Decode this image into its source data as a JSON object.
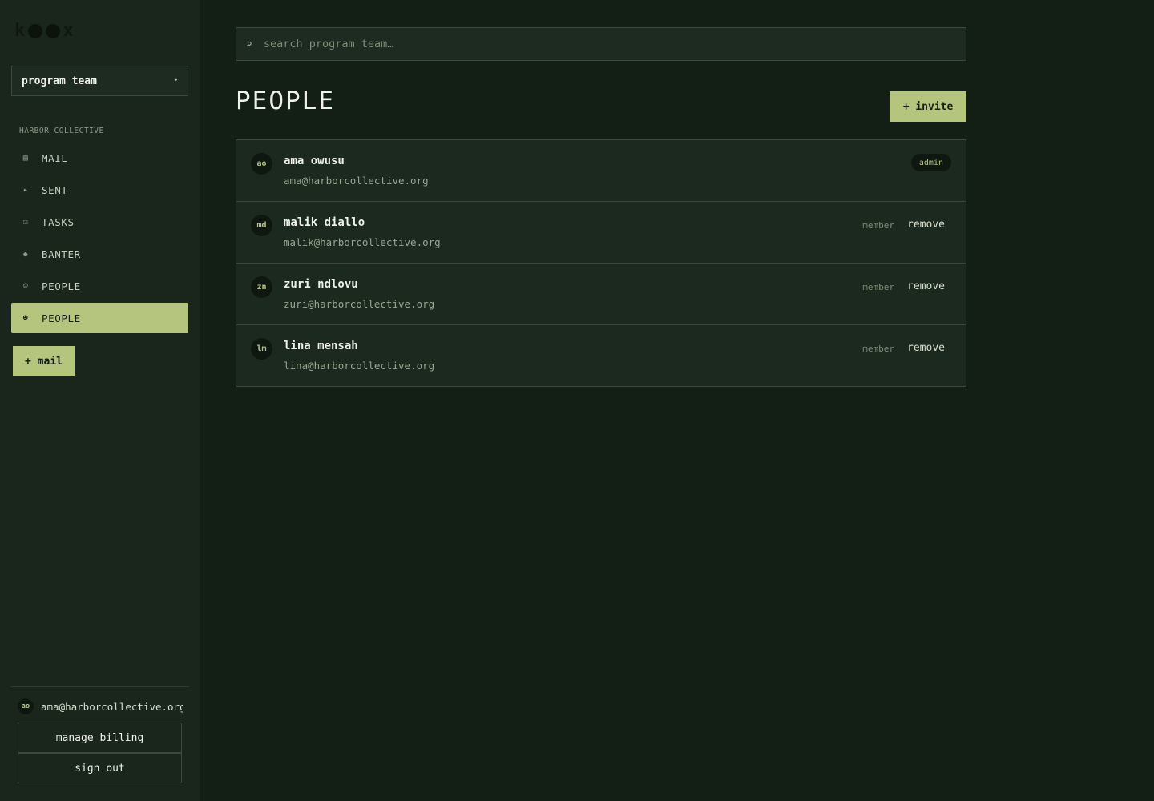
{
  "app": {
    "logo": "k○○x"
  },
  "sidebar": {
    "team_select": {
      "value": "program team"
    },
    "org_label": "HARBOR COLLECTIVE",
    "items": [
      {
        "label": "MAIL",
        "icon": "inbox-icon",
        "glyph": "▤",
        "active": false
      },
      {
        "label": "SENT",
        "icon": "send-icon",
        "glyph": "▸",
        "active": false
      },
      {
        "label": "TASKS",
        "icon": "checkbox-icon",
        "glyph": "☑",
        "active": false
      },
      {
        "label": "BANTER",
        "icon": "diamond-icon",
        "glyph": "◆",
        "active": false
      },
      {
        "label": "PEOPLE",
        "icon": "smiley-icon",
        "glyph": "☺",
        "active": false
      },
      {
        "label": "PEOPLE",
        "icon": "person-icon",
        "glyph": "☻",
        "active": true
      }
    ],
    "compose_label": "+ mail",
    "account": {
      "initials": "ao",
      "email": "ama@harborcollective.org"
    },
    "manage_billing_label": "manage billing",
    "sign_out_label": "sign out"
  },
  "search": {
    "placeholder": "search program team…",
    "value": ""
  },
  "page": {
    "title": "PEOPLE",
    "invite_label": "+ invite"
  },
  "people": [
    {
      "initials": "ao",
      "name": "ama owusu",
      "email": "ama@harborcollective.org",
      "badge": "admin"
    },
    {
      "initials": "md",
      "name": "malik diallo",
      "email": "malik@harborcollective.org",
      "role": "member",
      "action": "remove"
    },
    {
      "initials": "zn",
      "name": "zuri ndlovu",
      "email": "zuri@harborcollective.org",
      "role": "member",
      "action": "remove"
    },
    {
      "initials": "lm",
      "name": "lina mensah",
      "email": "lina@harborcollective.org",
      "role": "member",
      "action": "remove"
    }
  ],
  "colors": {
    "accent": "#b6c57e",
    "background": "#131f15",
    "sidebar": "#1a261c"
  }
}
